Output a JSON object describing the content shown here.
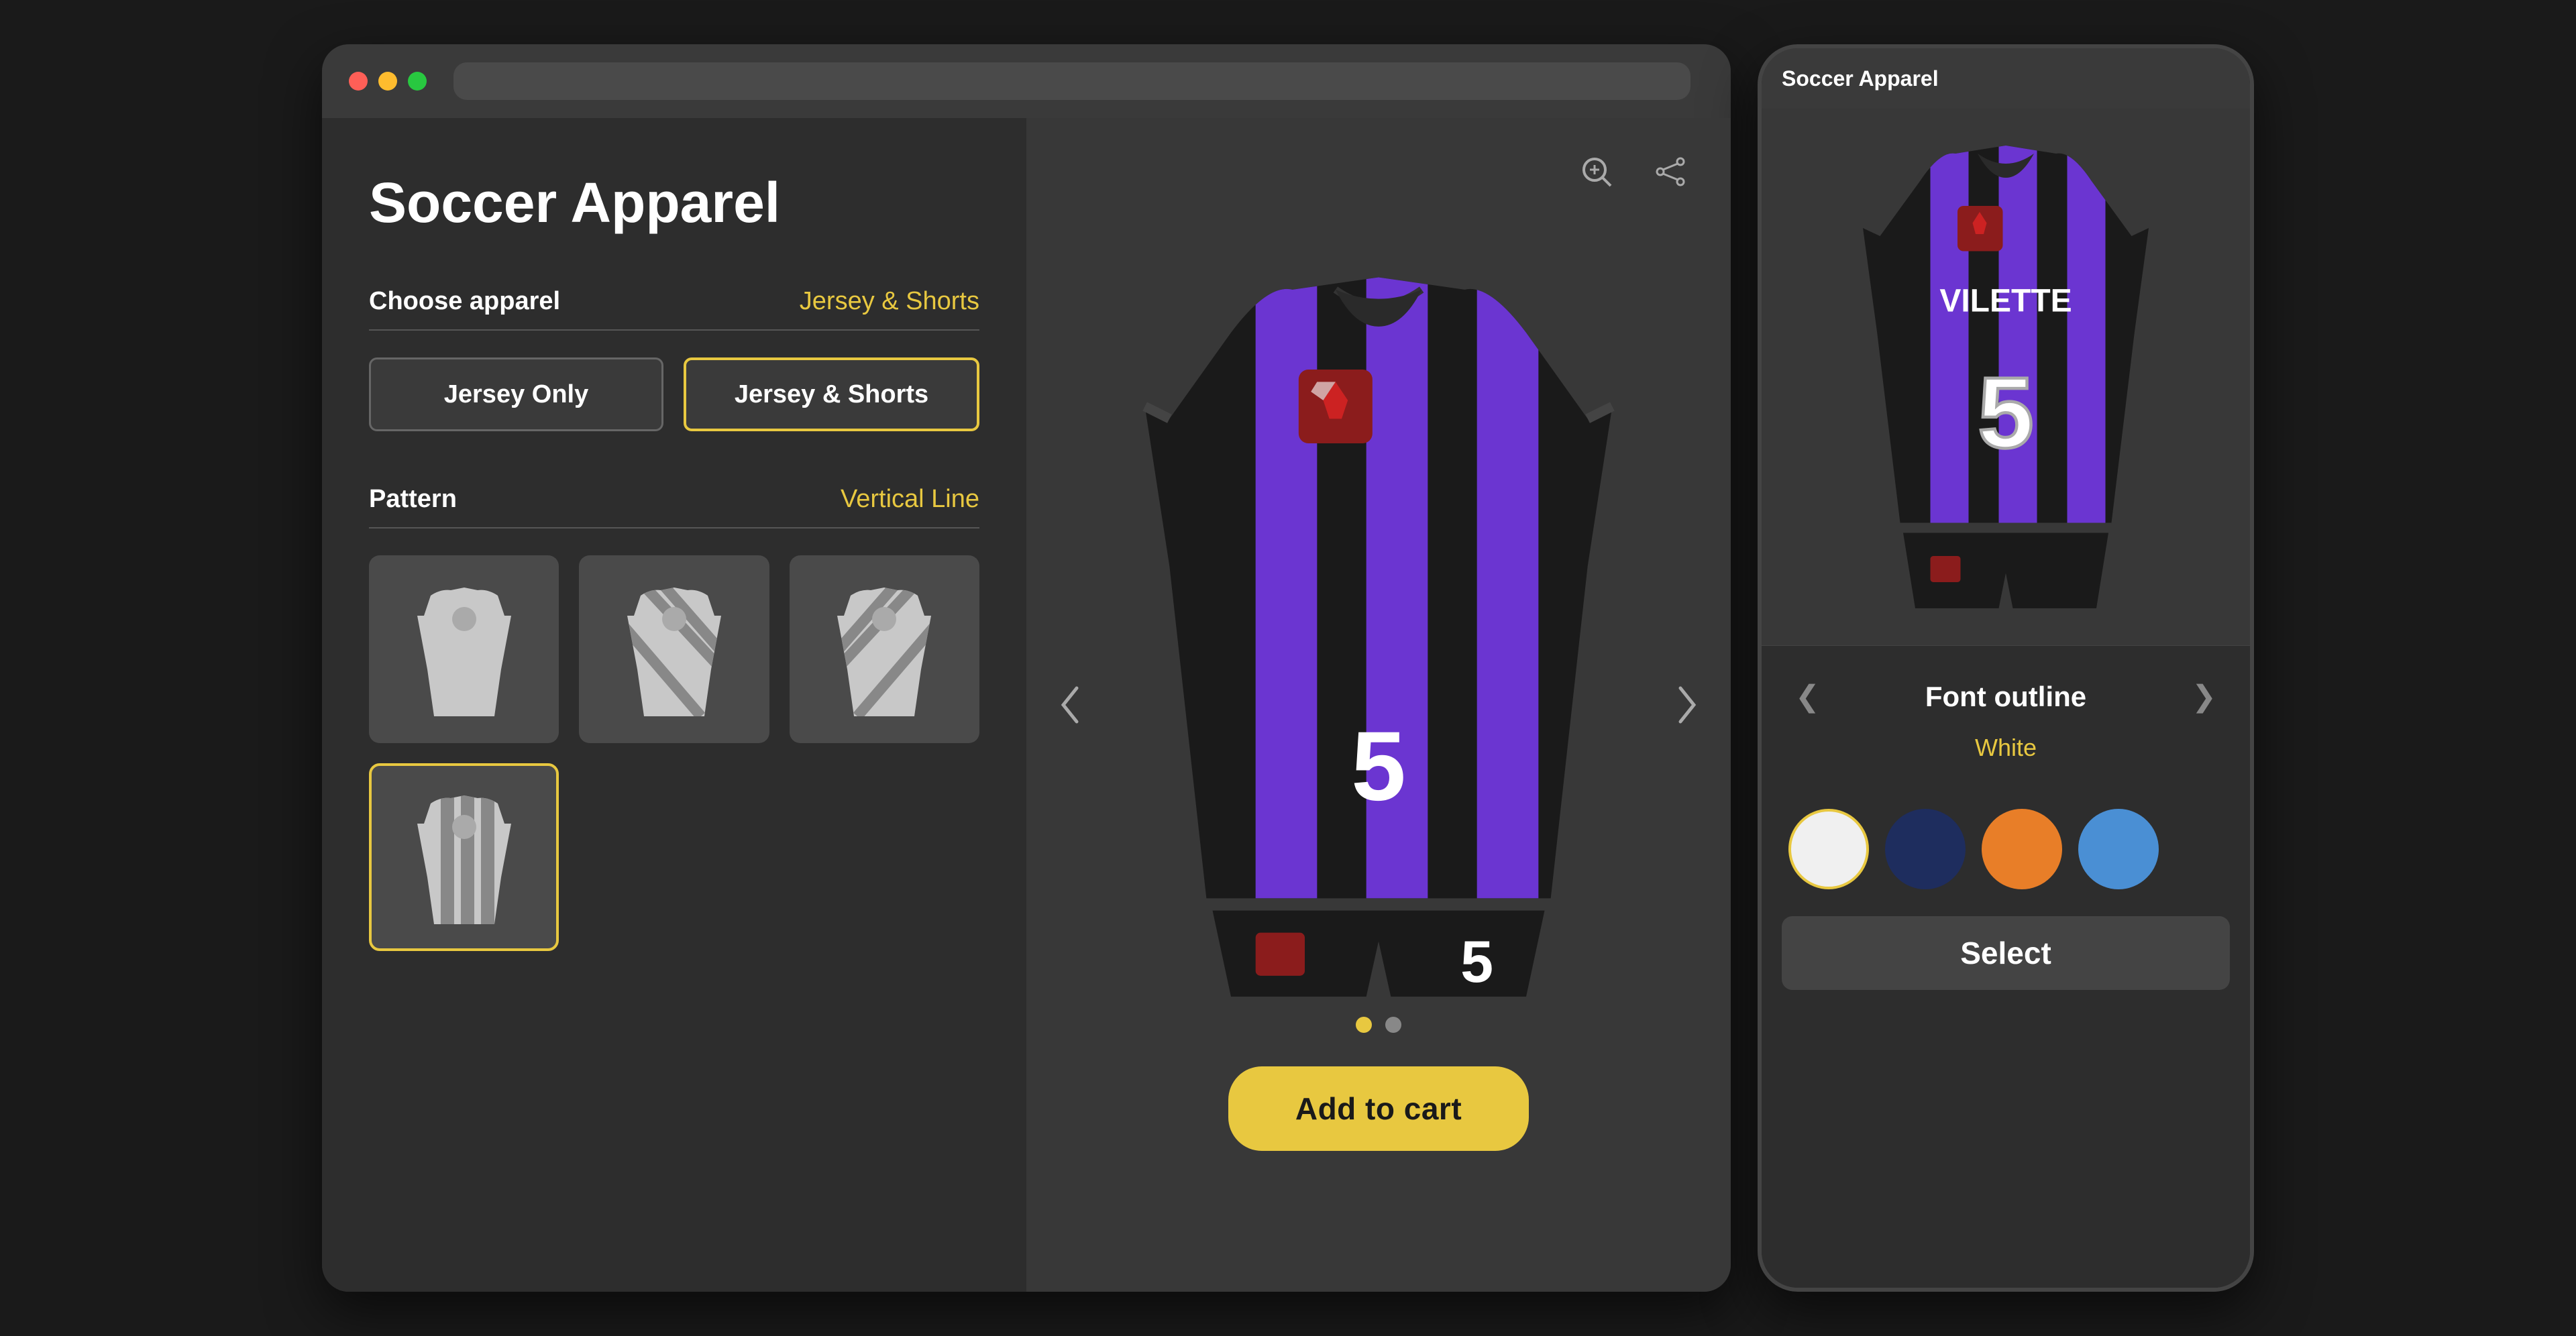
{
  "browser": {
    "title": "Soccer Apparel",
    "url": ""
  },
  "desktop": {
    "page_title": "Soccer Apparel",
    "choose_apparel": {
      "label": "Choose apparel",
      "value": "Jersey & Shorts",
      "options": [
        "Jersey Only",
        "Jersey & Shorts"
      ],
      "selected": "Jersey & Shorts"
    },
    "pattern": {
      "label": "Pattern",
      "value": "Vertical Line"
    },
    "add_to_cart": "Add to cart"
  },
  "mobile": {
    "title": "Soccer Apparel",
    "font_outline": {
      "label": "Font outline",
      "value": "White"
    },
    "select_btn": "Select",
    "colors": [
      "white",
      "navy",
      "orange",
      "blue"
    ]
  },
  "carousel": {
    "current": 0,
    "total": 2
  },
  "icons": {
    "zoom": "⊕",
    "share": "⋯",
    "arrow_left": "❮",
    "arrow_right": "❯"
  }
}
